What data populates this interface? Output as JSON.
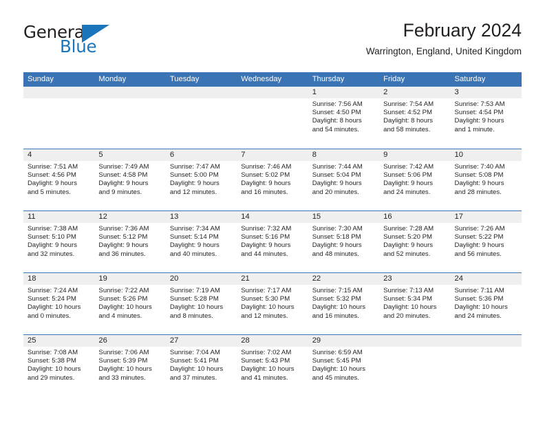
{
  "brand": {
    "name_part1": "General",
    "name_part2": "Blue",
    "logo_icon": "triangle-flag-icon",
    "colors": {
      "blue": "#1b75bb",
      "dark": "#231f20"
    }
  },
  "header": {
    "title": "February 2024",
    "subtitle": "Warrington, England, United Kingdom"
  },
  "theme": {
    "header_bg": "#3b74b5",
    "header_text": "#ffffff",
    "day_band_bg": "#efefef",
    "row_divider": "#3b74b5",
    "body_text": "#231f20"
  },
  "calendar": {
    "weekday_headers": [
      "Sunday",
      "Monday",
      "Tuesday",
      "Wednesday",
      "Thursday",
      "Friday",
      "Saturday"
    ],
    "weeks": [
      [
        {
          "day": "",
          "empty": true
        },
        {
          "day": "",
          "empty": true
        },
        {
          "day": "",
          "empty": true
        },
        {
          "day": "",
          "empty": true
        },
        {
          "day": "1",
          "sunrise": "Sunrise: 7:56 AM",
          "sunset": "Sunset: 4:50 PM",
          "daylight_line1": "Daylight: 8 hours",
          "daylight_line2": "and 54 minutes."
        },
        {
          "day": "2",
          "sunrise": "Sunrise: 7:54 AM",
          "sunset": "Sunset: 4:52 PM",
          "daylight_line1": "Daylight: 8 hours",
          "daylight_line2": "and 58 minutes."
        },
        {
          "day": "3",
          "sunrise": "Sunrise: 7:53 AM",
          "sunset": "Sunset: 4:54 PM",
          "daylight_line1": "Daylight: 9 hours",
          "daylight_line2": "and 1 minute."
        }
      ],
      [
        {
          "day": "4",
          "sunrise": "Sunrise: 7:51 AM",
          "sunset": "Sunset: 4:56 PM",
          "daylight_line1": "Daylight: 9 hours",
          "daylight_line2": "and 5 minutes."
        },
        {
          "day": "5",
          "sunrise": "Sunrise: 7:49 AM",
          "sunset": "Sunset: 4:58 PM",
          "daylight_line1": "Daylight: 9 hours",
          "daylight_line2": "and 9 minutes."
        },
        {
          "day": "6",
          "sunrise": "Sunrise: 7:47 AM",
          "sunset": "Sunset: 5:00 PM",
          "daylight_line1": "Daylight: 9 hours",
          "daylight_line2": "and 12 minutes."
        },
        {
          "day": "7",
          "sunrise": "Sunrise: 7:46 AM",
          "sunset": "Sunset: 5:02 PM",
          "daylight_line1": "Daylight: 9 hours",
          "daylight_line2": "and 16 minutes."
        },
        {
          "day": "8",
          "sunrise": "Sunrise: 7:44 AM",
          "sunset": "Sunset: 5:04 PM",
          "daylight_line1": "Daylight: 9 hours",
          "daylight_line2": "and 20 minutes."
        },
        {
          "day": "9",
          "sunrise": "Sunrise: 7:42 AM",
          "sunset": "Sunset: 5:06 PM",
          "daylight_line1": "Daylight: 9 hours",
          "daylight_line2": "and 24 minutes."
        },
        {
          "day": "10",
          "sunrise": "Sunrise: 7:40 AM",
          "sunset": "Sunset: 5:08 PM",
          "daylight_line1": "Daylight: 9 hours",
          "daylight_line2": "and 28 minutes."
        }
      ],
      [
        {
          "day": "11",
          "sunrise": "Sunrise: 7:38 AM",
          "sunset": "Sunset: 5:10 PM",
          "daylight_line1": "Daylight: 9 hours",
          "daylight_line2": "and 32 minutes."
        },
        {
          "day": "12",
          "sunrise": "Sunrise: 7:36 AM",
          "sunset": "Sunset: 5:12 PM",
          "daylight_line1": "Daylight: 9 hours",
          "daylight_line2": "and 36 minutes."
        },
        {
          "day": "13",
          "sunrise": "Sunrise: 7:34 AM",
          "sunset": "Sunset: 5:14 PM",
          "daylight_line1": "Daylight: 9 hours",
          "daylight_line2": "and 40 minutes."
        },
        {
          "day": "14",
          "sunrise": "Sunrise: 7:32 AM",
          "sunset": "Sunset: 5:16 PM",
          "daylight_line1": "Daylight: 9 hours",
          "daylight_line2": "and 44 minutes."
        },
        {
          "day": "15",
          "sunrise": "Sunrise: 7:30 AM",
          "sunset": "Sunset: 5:18 PM",
          "daylight_line1": "Daylight: 9 hours",
          "daylight_line2": "and 48 minutes."
        },
        {
          "day": "16",
          "sunrise": "Sunrise: 7:28 AM",
          "sunset": "Sunset: 5:20 PM",
          "daylight_line1": "Daylight: 9 hours",
          "daylight_line2": "and 52 minutes."
        },
        {
          "day": "17",
          "sunrise": "Sunrise: 7:26 AM",
          "sunset": "Sunset: 5:22 PM",
          "daylight_line1": "Daylight: 9 hours",
          "daylight_line2": "and 56 minutes."
        }
      ],
      [
        {
          "day": "18",
          "sunrise": "Sunrise: 7:24 AM",
          "sunset": "Sunset: 5:24 PM",
          "daylight_line1": "Daylight: 10 hours",
          "daylight_line2": "and 0 minutes."
        },
        {
          "day": "19",
          "sunrise": "Sunrise: 7:22 AM",
          "sunset": "Sunset: 5:26 PM",
          "daylight_line1": "Daylight: 10 hours",
          "daylight_line2": "and 4 minutes."
        },
        {
          "day": "20",
          "sunrise": "Sunrise: 7:19 AM",
          "sunset": "Sunset: 5:28 PM",
          "daylight_line1": "Daylight: 10 hours",
          "daylight_line2": "and 8 minutes."
        },
        {
          "day": "21",
          "sunrise": "Sunrise: 7:17 AM",
          "sunset": "Sunset: 5:30 PM",
          "daylight_line1": "Daylight: 10 hours",
          "daylight_line2": "and 12 minutes."
        },
        {
          "day": "22",
          "sunrise": "Sunrise: 7:15 AM",
          "sunset": "Sunset: 5:32 PM",
          "daylight_line1": "Daylight: 10 hours",
          "daylight_line2": "and 16 minutes."
        },
        {
          "day": "23",
          "sunrise": "Sunrise: 7:13 AM",
          "sunset": "Sunset: 5:34 PM",
          "daylight_line1": "Daylight: 10 hours",
          "daylight_line2": "and 20 minutes."
        },
        {
          "day": "24",
          "sunrise": "Sunrise: 7:11 AM",
          "sunset": "Sunset: 5:36 PM",
          "daylight_line1": "Daylight: 10 hours",
          "daylight_line2": "and 24 minutes."
        }
      ],
      [
        {
          "day": "25",
          "sunrise": "Sunrise: 7:08 AM",
          "sunset": "Sunset: 5:38 PM",
          "daylight_line1": "Daylight: 10 hours",
          "daylight_line2": "and 29 minutes."
        },
        {
          "day": "26",
          "sunrise": "Sunrise: 7:06 AM",
          "sunset": "Sunset: 5:39 PM",
          "daylight_line1": "Daylight: 10 hours",
          "daylight_line2": "and 33 minutes."
        },
        {
          "day": "27",
          "sunrise": "Sunrise: 7:04 AM",
          "sunset": "Sunset: 5:41 PM",
          "daylight_line1": "Daylight: 10 hours",
          "daylight_line2": "and 37 minutes."
        },
        {
          "day": "28",
          "sunrise": "Sunrise: 7:02 AM",
          "sunset": "Sunset: 5:43 PM",
          "daylight_line1": "Daylight: 10 hours",
          "daylight_line2": "and 41 minutes."
        },
        {
          "day": "29",
          "sunrise": "Sunrise: 6:59 AM",
          "sunset": "Sunset: 5:45 PM",
          "daylight_line1": "Daylight: 10 hours",
          "daylight_line2": "and 45 minutes."
        },
        {
          "day": "",
          "empty": true
        },
        {
          "day": "",
          "empty": true
        }
      ]
    ]
  }
}
